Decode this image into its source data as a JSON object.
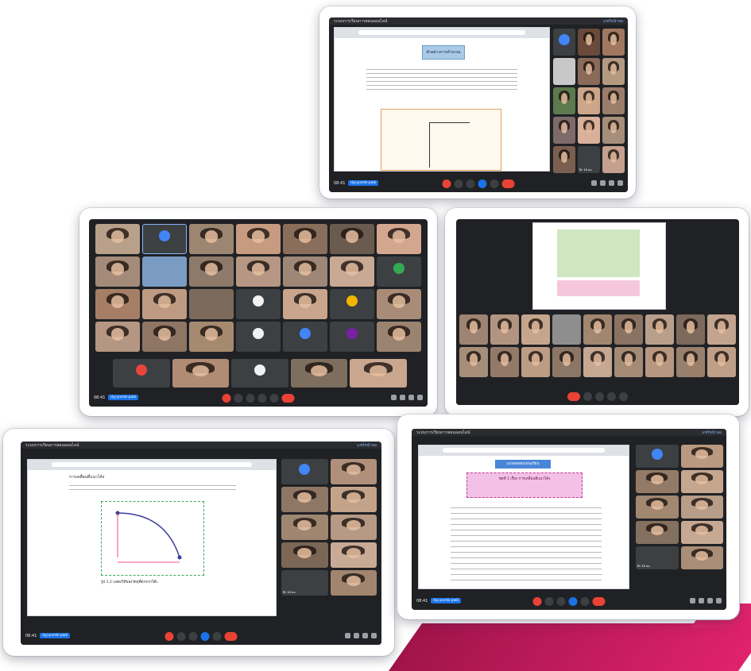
{
  "meet": {
    "clock": "08:41",
    "meeting_code": "dyj-pxmb-pwb",
    "top_title": "ระบบการเรียนการสอนออนไลน์",
    "top_right": "แชร์หน้าจอ",
    "participants_count": "อีก 18 คน"
  },
  "screens": {
    "s1": {
      "slide_title": "ตัวอย่างการคำนวณ",
      "label": "screenshot-1"
    },
    "s4": {
      "slide_title": "การเคลื่อนที่แนวโค้ง",
      "caption": "รูป 1.2 แสดงวิถีของวัตถุที่ตกจากโต๊ะ"
    },
    "s5": {
      "slide_title": "แบบทดสอบก่อนเรียน",
      "box_title": "ชุดที่ 1 เรื่อง การเคลื่อนที่แนวโค้ง"
    }
  },
  "colors": {
    "accent_pink": "#e0226c",
    "accent_dark": "#a0144b",
    "meet_bg": "#202124",
    "end_call": "#ea4335",
    "blue": "#1a73e8"
  },
  "icons": [
    "mic-icon",
    "camera-icon",
    "hand-icon",
    "present-icon",
    "more-icon",
    "end-call-icon",
    "info-icon",
    "people-icon",
    "chat-icon",
    "activities-icon"
  ]
}
